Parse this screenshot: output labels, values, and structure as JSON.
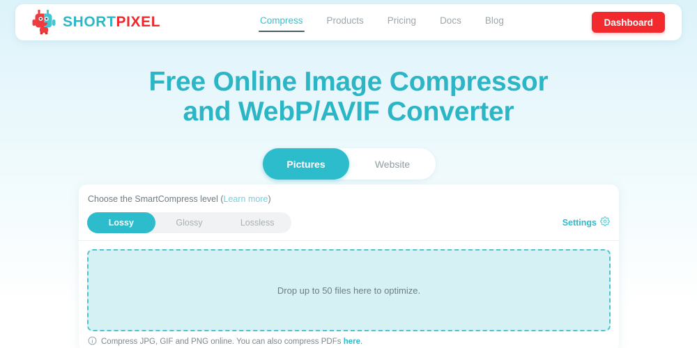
{
  "header": {
    "logo": {
      "icon": "shortpixel-robot-logo",
      "text_primary": "SHORT",
      "text_secondary": "PIXEL"
    },
    "nav": [
      {
        "label": "Compress",
        "active": true
      },
      {
        "label": "Products",
        "active": false
      },
      {
        "label": "Pricing",
        "active": false
      },
      {
        "label": "Docs",
        "active": false
      },
      {
        "label": "Blog",
        "active": false
      }
    ],
    "dashboard_button": "Dashboard"
  },
  "hero": {
    "title_line1": "Free Online Image Compressor",
    "title_line2": "and WebP/AVIF Converter"
  },
  "mode_toggle": {
    "options": [
      {
        "label": "Pictures",
        "active": true
      },
      {
        "label": "Website",
        "active": false
      }
    ]
  },
  "compress_card": {
    "label_prefix": "Choose the SmartCompress level (",
    "label_link": "Learn more",
    "label_suffix": ")",
    "levels": [
      {
        "label": "Lossy",
        "active": true
      },
      {
        "label": "Glossy",
        "active": false
      },
      {
        "label": "Lossless",
        "active": false
      }
    ],
    "settings_label": "Settings",
    "settings_icon": "gear-icon",
    "dropzone_text": "Drop up to 50 files here to optimize.",
    "note_icon": "info-icon",
    "note_prefix": "Compress JPG, GIF and PNG online. You can also compress PDFs ",
    "note_link": "here",
    "note_suffix": "."
  },
  "colors": {
    "accent_teal": "#2cbccb",
    "brand_red": "#f22a2e",
    "heading_teal": "#2cb5c4",
    "dropzone_fill": "#d6f1f3",
    "dropzone_border": "#4ec3d0"
  }
}
